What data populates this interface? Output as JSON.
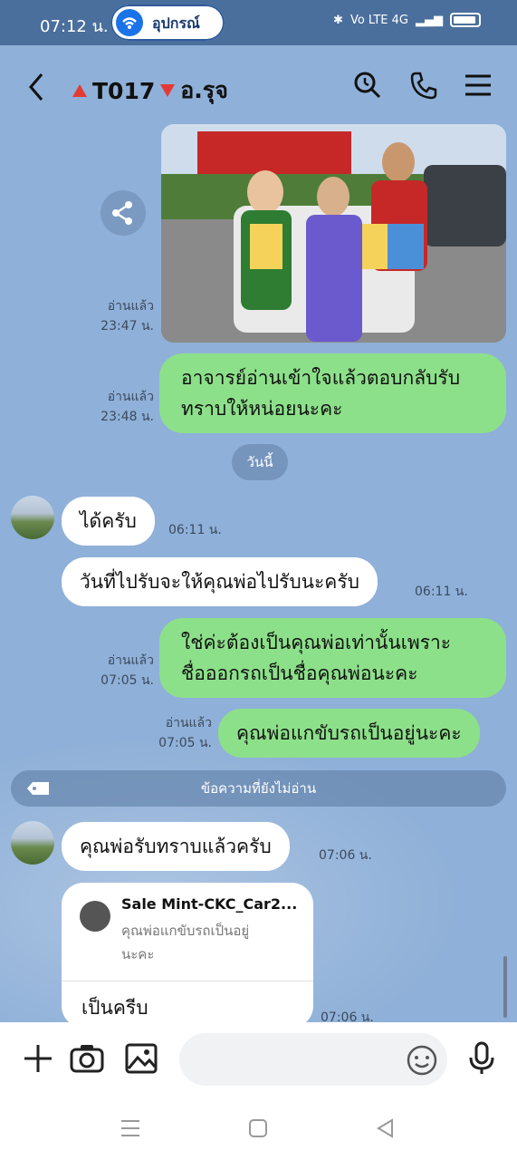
{
  "status_bar": {
    "time": "07:12 น.",
    "pill_label": "อุปกรณ์",
    "network": "Vo LTE 4G"
  },
  "header": {
    "title_code": "T017",
    "title_name": "อ.รุจ"
  },
  "messages": [
    {
      "id": "photo",
      "type": "image",
      "read": "อ่านแล้ว",
      "time": "23:47 น."
    },
    {
      "id": "m1",
      "type": "text",
      "direction": "out",
      "text_line1": "อาจารย์อ่านเข้าใจแล้วตอบกลับรับ",
      "text_line2": "ทราบให้หน่อยนะคะ",
      "read": "อ่านแล้ว",
      "time": "23:48 น."
    },
    {
      "id": "m2",
      "type": "text",
      "direction": "in",
      "text": "ได้ครับ",
      "time": "06:11 น."
    },
    {
      "id": "m3",
      "type": "text",
      "direction": "in",
      "text": "วันที่ไปรับจะให้คุณพ่อไปรับนะครับ",
      "time": "06:11 น."
    },
    {
      "id": "m4",
      "type": "text",
      "direction": "out",
      "text_line1": "ใช่ค่ะต้องเป็นคุณพ่อเท่านั้นเพราะ",
      "text_line2": "ชื่อออกรถเป็นชื่อคุณพ่อนะคะ",
      "read": "อ่านแล้ว",
      "time": "07:05 น."
    },
    {
      "id": "m5",
      "type": "text",
      "direction": "out",
      "text": "คุณพ่อแกขับรถเป็นอยู่นะคะ",
      "read": "อ่านแล้ว",
      "time": "07:05 น."
    },
    {
      "id": "m6",
      "type": "text",
      "direction": "in",
      "text": "คุณพ่อรับทราบแล้วครับ",
      "time": "07:06 น."
    },
    {
      "id": "m7",
      "type": "reply",
      "direction": "in",
      "quoted_name": "Sale Mint-CKC_Car2...",
      "quoted_line1": "คุณพ่อแกขับรถเป็นอยู่",
      "quoted_line2": "นะคะ",
      "text": "เป็นครีบ",
      "time": "07:06 น."
    }
  ],
  "date_separator": "วันนี้",
  "unread_label": "ข้อความที่ยังไม่อ่าน",
  "input": {
    "placeholder": ""
  },
  "colors": {
    "background": "#8fb0d8",
    "outgoing": "#8de08a",
    "incoming": "#ffffff",
    "status_bar": "#4a6f9d"
  },
  "icons": [
    "back-icon",
    "search-icon",
    "phone-icon",
    "menu-icon",
    "share-icon",
    "tag-icon",
    "plus-icon",
    "camera-icon",
    "image-icon",
    "emoji-icon",
    "mic-icon"
  ]
}
